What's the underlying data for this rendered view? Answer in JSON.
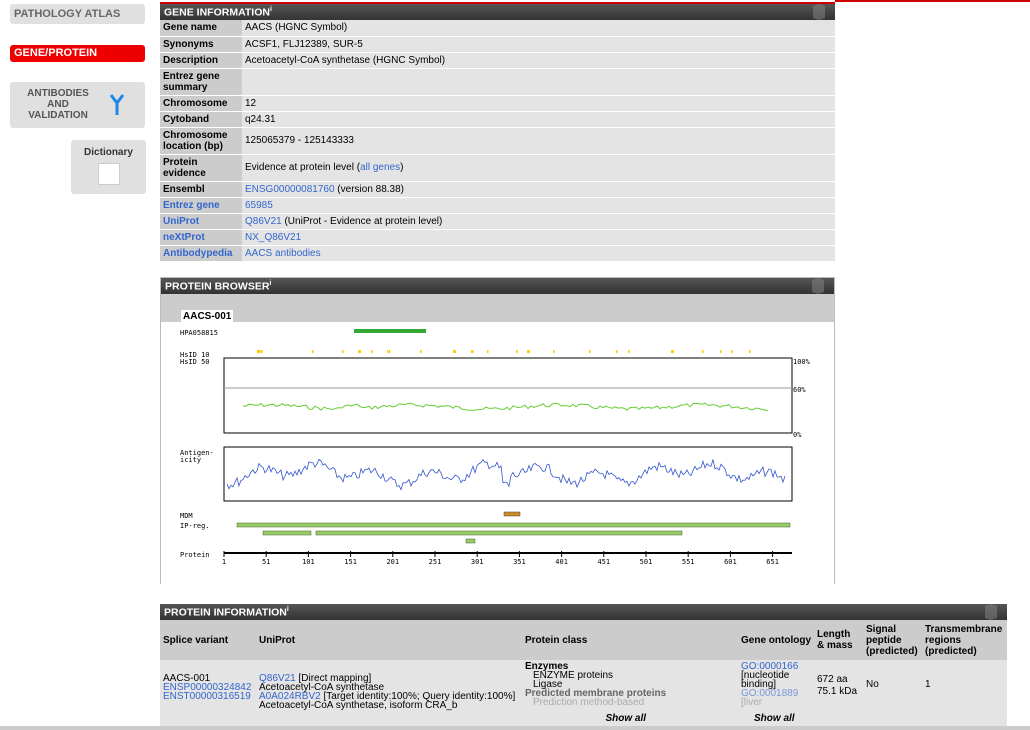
{
  "nav": {
    "pathology": "PATHOLOGY ATLAS",
    "gene_protein": "GENE/PROTEIN",
    "antibodies": "ANTIBODIES AND VALIDATION",
    "dictionary": "Dictionary"
  },
  "gene_info": {
    "title": "GENE INFORMATION",
    "rows": [
      {
        "k": "Gene name",
        "v": "AACS (HGNC Symbol)"
      },
      {
        "k": "Synonyms",
        "v": "ACSF1, FLJ12389, SUR-5"
      },
      {
        "k": "Description",
        "v": "Acetoacetyl-CoA synthetase (HGNC Symbol)"
      },
      {
        "k": "Entrez gene summary",
        "v": ""
      },
      {
        "k": "Chromosome",
        "v": "12"
      },
      {
        "k": "Cytoband",
        "v": "q24.31"
      },
      {
        "k": "Chromosome location (bp)",
        "v": "125065379 - 125143333"
      },
      {
        "k": "Protein evidence",
        "v": "Evidence at protein level (",
        "link": "all genes",
        "v2": ")"
      },
      {
        "k": "Ensembl",
        "link": "ENSG00000081760",
        "v2": " (version 88.38)"
      },
      {
        "k": "Entrez gene",
        "klink": true,
        "link": "65985"
      },
      {
        "k": "UniProt",
        "klink": true,
        "link": "Q86V21",
        "v2": " (UniProt - Evidence at protein level)"
      },
      {
        "k": "neXtProt",
        "klink": true,
        "link": "NX_Q86V21"
      },
      {
        "k": "Antibodypedia",
        "klink": true,
        "link": "AACS antibodies"
      }
    ]
  },
  "protein_browser": {
    "title": "PROTEIN BROWSER",
    "transcript": "AACS-001",
    "labels": {
      "hpa": "HPA058815",
      "hs10": "HsID 10",
      "hs50": "HsID 50",
      "p100": "100%",
      "p60": "60%",
      "p0": "0%",
      "antigen1": "Antigen-",
      "antigen2": "icity",
      "mdm": "MDM",
      "ipreg": "IP-reg.",
      "protein": "Protein"
    },
    "axis_ticks": [
      "1",
      "51",
      "101",
      "151",
      "201",
      "251",
      "301",
      "351",
      "401",
      "451",
      "501",
      "551",
      "601",
      "651"
    ]
  },
  "protein_info": {
    "title": "PROTEIN INFORMATION",
    "headers": [
      "Splice variant",
      "UniProt",
      "Protein class",
      "Gene ontology",
      "Length & mass",
      "Signal peptide (predicted)",
      "Transmembrane regions (predicted)"
    ],
    "row": {
      "splice": "AACS-001",
      "ensp": "ENSP00000324842",
      "enst": "ENST00000316519",
      "uni1_link": "Q86V21",
      "uni1_text": " [Direct mapping]",
      "uni1_desc": "Acetoacetyl-CoA synthetase",
      "uni2_link": "A0A024RBV2",
      "uni2_text": " [Target identity:100%; Query identity:100%]",
      "uni2_desc": "Acetoacetyl-CoA synthetase, isoform CRA_b",
      "pc1": "Enzymes",
      "pc2": "ENZYME proteins",
      "pc3": "Ligase",
      "pc4": "Predicted membrane proteins",
      "pc5": "Prediction method-based",
      "go1": "GO:0000166",
      "go1d": "[nucleotide binding]",
      "go2": "GO:0001889",
      "go2d": "[liver",
      "length": "672 aa",
      "mass": "75.1 kDa",
      "signal": "No",
      "tm": "1",
      "show_all": "Show all"
    }
  }
}
